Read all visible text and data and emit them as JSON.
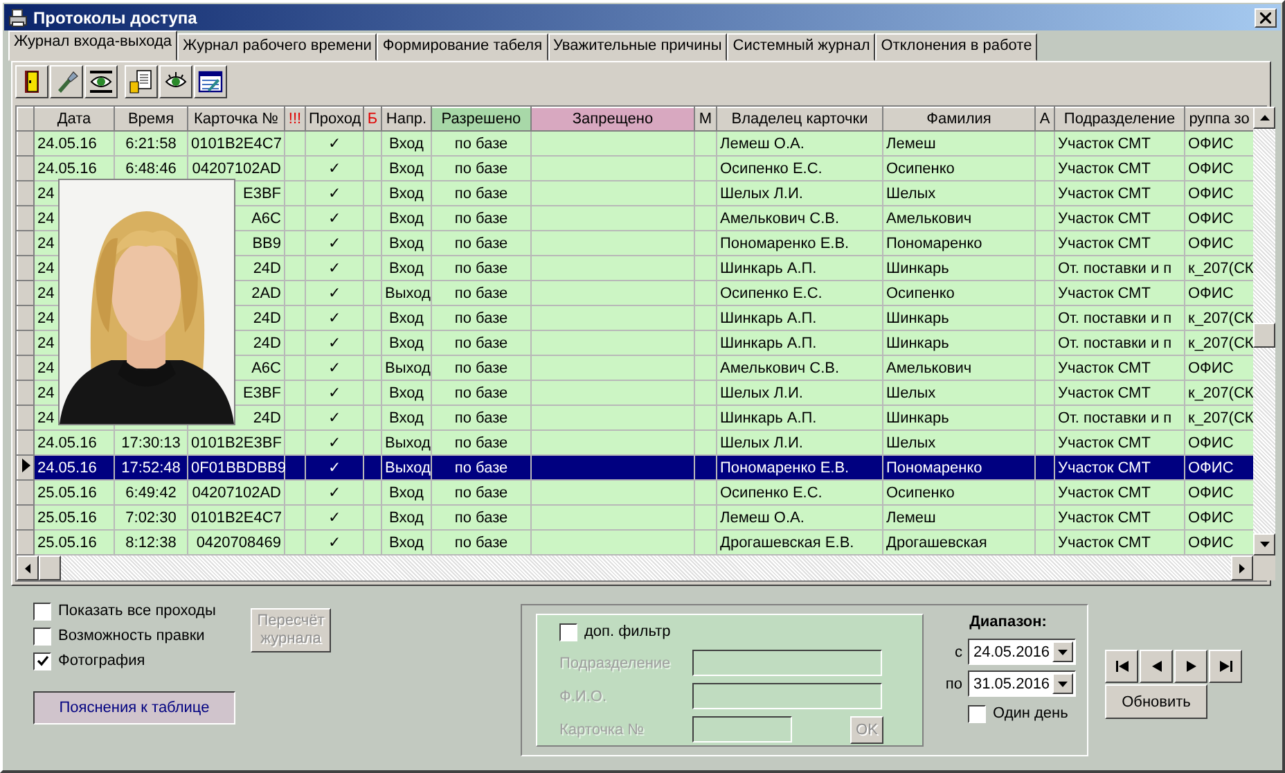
{
  "window": {
    "title": "Протоколы доступа"
  },
  "tabs": [
    {
      "label": "Журнал входа-выхода",
      "selected": true
    },
    {
      "label": "Журнал рабочего времени",
      "selected": false
    },
    {
      "label": "Формирование табеля",
      "selected": false
    },
    {
      "label": "Уважительные причины",
      "selected": false
    },
    {
      "label": "Системный журнал",
      "selected": false
    },
    {
      "label": "Отклонения в работе",
      "selected": false
    }
  ],
  "columns": [
    {
      "label": "Дата",
      "kind": "plain"
    },
    {
      "label": "Время",
      "kind": "plain"
    },
    {
      "label": "Карточка №",
      "kind": "plain"
    },
    {
      "label": "!!!",
      "kind": "alert"
    },
    {
      "label": "Проход",
      "kind": "plain"
    },
    {
      "label": "Б",
      "kind": "alert"
    },
    {
      "label": "Напр.",
      "kind": "plain"
    },
    {
      "label": "Разрешено",
      "kind": "allowed"
    },
    {
      "label": "Запрещено",
      "kind": "denied"
    },
    {
      "label": "М",
      "kind": "plain"
    },
    {
      "label": "Владелец карточки",
      "kind": "plain"
    },
    {
      "label": "Фамилия",
      "kind": "plain"
    },
    {
      "label": "А",
      "kind": "plain"
    },
    {
      "label": "Подразделение",
      "kind": "plain"
    },
    {
      "label": "руппа зо",
      "kind": "plain"
    }
  ],
  "rows": [
    {
      "date": "24.05.16",
      "time": "6:21:58",
      "card": "0101B2E4C7",
      "pass": "✓",
      "direction": "Вход",
      "allowed": "по базе",
      "owner": "Лемеш О.А.",
      "surname": "Лемеш",
      "department": "Участок СМТ",
      "group": "ОФИС",
      "selected": false
    },
    {
      "date": "24.05.16",
      "time": "6:48:46",
      "card": "04207102AD",
      "pass": "✓",
      "direction": "Вход",
      "allowed": "по базе",
      "owner": "Осипенко Е.С.",
      "surname": "Осипенко",
      "department": "Участок СМТ",
      "group": "ОФИС",
      "selected": false
    },
    {
      "date": "24",
      "card": "E3BF",
      "pass": "✓",
      "direction": "Вход",
      "allowed": "по базе",
      "owner": "Шелых Л.И.",
      "surname": "Шелых",
      "department": "Участок СМТ",
      "group": "ОФИС",
      "selected": false
    },
    {
      "date": "24",
      "card": "A6C",
      "pass": "✓",
      "direction": "Вход",
      "allowed": "по базе",
      "owner": "Амелькович С.В.",
      "surname": "Амелькович",
      "department": "Участок СМТ",
      "group": "ОФИС",
      "selected": false
    },
    {
      "date": "24",
      "card": "BB9",
      "pass": "✓",
      "direction": "Вход",
      "allowed": "по базе",
      "owner": "Пономаренко Е.В.",
      "surname": "Пономаренко",
      "department": "Участок СМТ",
      "group": "ОФИС",
      "selected": false
    },
    {
      "date": "24",
      "card": "24D",
      "pass": "✓",
      "direction": "Вход",
      "allowed": "по базе",
      "owner": "Шинкарь А.П.",
      "surname": "Шинкарь",
      "department": "От. поставки и п",
      "group": "к_207(СК",
      "selected": false
    },
    {
      "date": "24",
      "card": "2AD",
      "pass": "✓",
      "direction": "Выход",
      "allowed": "по базе",
      "owner": "Осипенко Е.С.",
      "surname": "Осипенко",
      "department": "Участок СМТ",
      "group": "ОФИС",
      "selected": false
    },
    {
      "date": "24",
      "card": "24D",
      "pass": "✓",
      "direction": "Вход",
      "allowed": "по базе",
      "owner": "Шинкарь А.П.",
      "surname": "Шинкарь",
      "department": "От. поставки и п",
      "group": "к_207(СК",
      "selected": false
    },
    {
      "date": "24",
      "card": "24D",
      "pass": "✓",
      "direction": "Вход",
      "allowed": "по базе",
      "owner": "Шинкарь А.П.",
      "surname": "Шинкарь",
      "department": "От. поставки и п",
      "group": "к_207(СК",
      "selected": false
    },
    {
      "date": "24",
      "card": "A6C",
      "pass": "✓",
      "direction": "Выход",
      "allowed": "по базе",
      "owner": "Амелькович С.В.",
      "surname": "Амелькович",
      "department": "Участок СМТ",
      "group": "ОФИС",
      "selected": false
    },
    {
      "date": "24",
      "card": "E3BF",
      "pass": "✓",
      "direction": "Вход",
      "allowed": "по базе",
      "owner": "Шелых Л.И.",
      "surname": "Шелых",
      "department": "Участок СМТ",
      "group": "к_207(СК",
      "selected": false
    },
    {
      "date": "24",
      "card": "24D",
      "pass": "✓",
      "direction": "Вход",
      "allowed": "по базе",
      "owner": "Шинкарь А.П.",
      "surname": "Шинкарь",
      "department": "От. поставки и п",
      "group": "к_207(СК",
      "selected": false
    },
    {
      "date": "24.05.16",
      "time": "17:30:13",
      "card": "0101B2E3BF",
      "pass": "✓",
      "direction": "Выход",
      "allowed": "по базе",
      "owner": "Шелых Л.И.",
      "surname": "Шелых",
      "department": "Участок СМТ",
      "group": "ОФИС",
      "selected": false
    },
    {
      "date": "24.05.16",
      "time": "17:52:48",
      "card": "0F01BBDBB9",
      "pass": "✓",
      "direction": "Выход",
      "allowed": "по базе",
      "owner": "Пономаренко Е.В.",
      "surname": "Пономаренко",
      "department": "Участок СМТ",
      "group": "ОФИС",
      "selected": true
    },
    {
      "date": "25.05.16",
      "time": "6:49:42",
      "card": "04207102AD",
      "pass": "✓",
      "direction": "Вход",
      "allowed": "по базе",
      "owner": "Осипенко Е.С.",
      "surname": "Осипенко",
      "department": "Участок СМТ",
      "group": "ОФИС",
      "selected": false
    },
    {
      "date": "25.05.16",
      "time": "7:02:30",
      "card": "0101B2E4C7",
      "pass": "✓",
      "direction": "Вход",
      "allowed": "по базе",
      "owner": "Лемеш О.А.",
      "surname": "Лемеш",
      "department": "Участок СМТ",
      "group": "ОФИС",
      "selected": false
    },
    {
      "date": "25.05.16",
      "time": "8:12:38",
      "card": "0420708469",
      "pass": "✓",
      "direction": "Вход",
      "allowed": "по базе",
      "owner": "Дрогашевская Е.В.",
      "surname": "Дрогашевская",
      "department": "Участок СМТ",
      "group": "ОФИС",
      "selected": false
    }
  ],
  "options": [
    {
      "label": "Показать все проходы",
      "checked": false
    },
    {
      "label": "Возможность правки",
      "checked": false
    },
    {
      "label": "Фотография",
      "checked": true
    }
  ],
  "recalc_button": {
    "label": "Пересчёт журнала",
    "disabled": true
  },
  "legend_button": {
    "label": "Пояснения к таблице"
  },
  "filter": {
    "label": "доп. фильтр",
    "checked": false,
    "disabled": true,
    "fields": [
      {
        "label": "Подразделение"
      },
      {
        "label": "Ф.И.О."
      },
      {
        "label": "Карточка №"
      }
    ],
    "ok_button": "OK"
  },
  "range": {
    "title": "Диапазон:",
    "from": {
      "label": "с",
      "value": "24.05.2016"
    },
    "to": {
      "label": "по",
      "value": "31.05.2016"
    },
    "one_day": {
      "label": "Один день",
      "checked": false
    }
  },
  "refresh_button": "Обновить"
}
